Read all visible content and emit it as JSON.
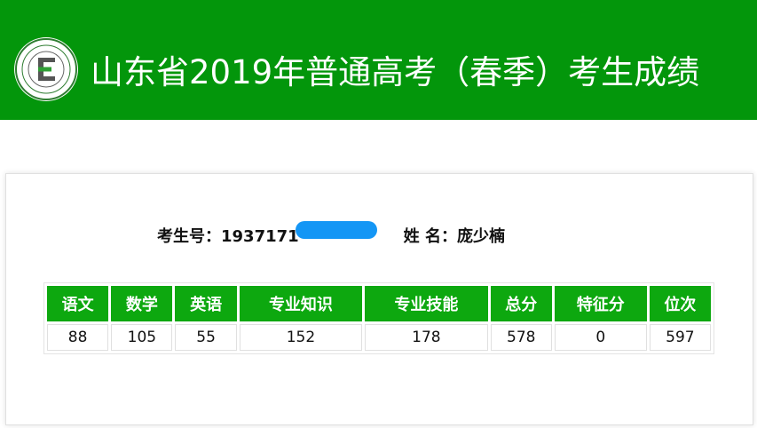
{
  "header": {
    "title": "山东省2019年普通高考（春季）考生成绩",
    "logo_icon": "exam-authority-seal-icon",
    "brand_color": "#03960b"
  },
  "candidate": {
    "id_label": "考生号：",
    "id_value": "1937171",
    "name_label": "姓 名：",
    "name_value": "庞少楠"
  },
  "scores": {
    "header_color": "#0da80f",
    "columns": [
      "语文",
      "数学",
      "英语",
      "专业知识",
      "专业技能",
      "总分",
      "特征分",
      "位次"
    ],
    "values": [
      "88",
      "105",
      "55",
      "152",
      "178",
      "578",
      "0",
      "597"
    ]
  }
}
